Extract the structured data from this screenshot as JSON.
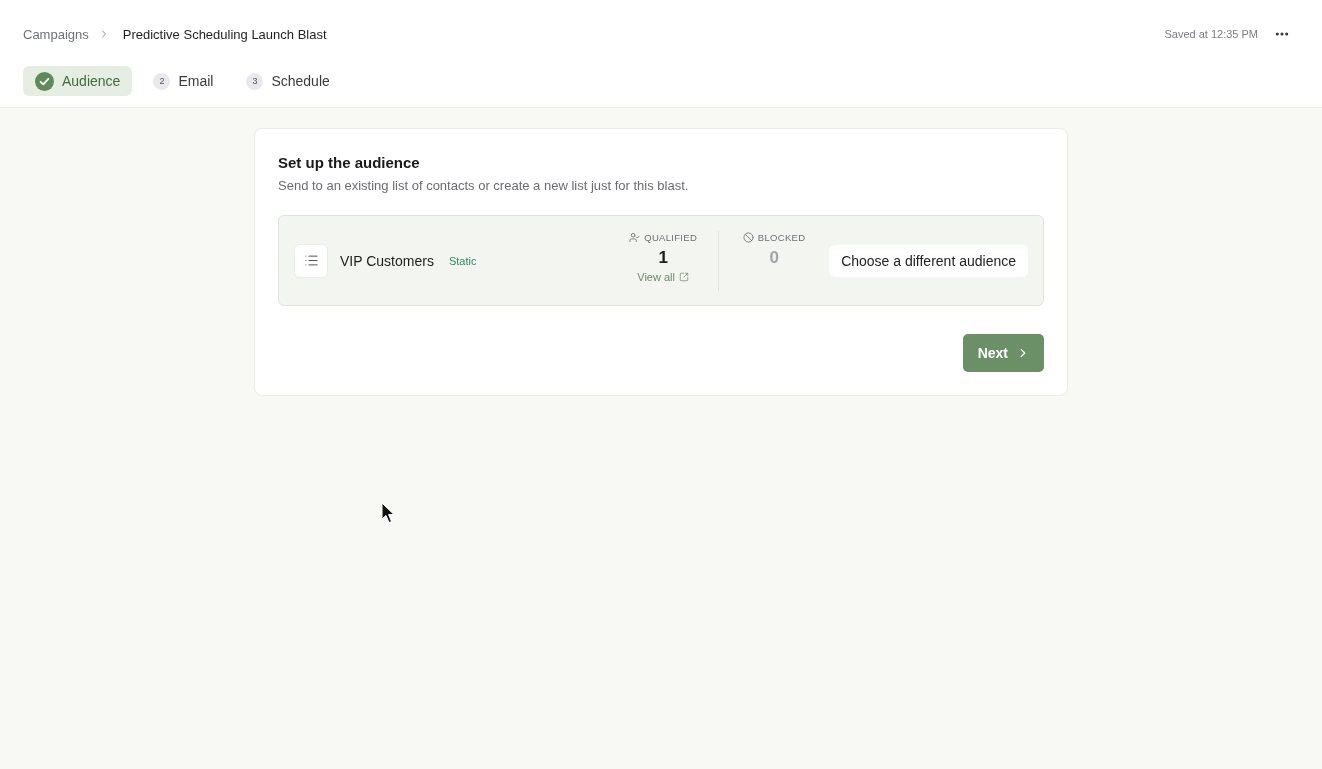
{
  "breadcrumb": {
    "parent": "Campaigns",
    "current": "Predictive Scheduling Launch Blast"
  },
  "save_status": "Saved at 12:35 PM",
  "steps": [
    {
      "label": "Audience",
      "completed": true,
      "selected": true
    },
    {
      "number": "2",
      "label": "Email",
      "completed": false,
      "selected": false
    },
    {
      "number": "3",
      "label": "Schedule",
      "completed": false,
      "selected": false
    }
  ],
  "audience_setup": {
    "title": "Set up the audience",
    "description": "Send to an existing list of contacts or create a new list just for this blast.",
    "audience": {
      "name": "VIP Customers",
      "type": "Static"
    },
    "stats": [
      {
        "kind": "qualified",
        "label": "QUALIFIED",
        "value": "1",
        "link": "View all"
      },
      {
        "kind": "blocked",
        "label": "BLOCKED",
        "value": "0"
      }
    ],
    "change_button": "Choose a different audience",
    "next_button": "Next"
  }
}
